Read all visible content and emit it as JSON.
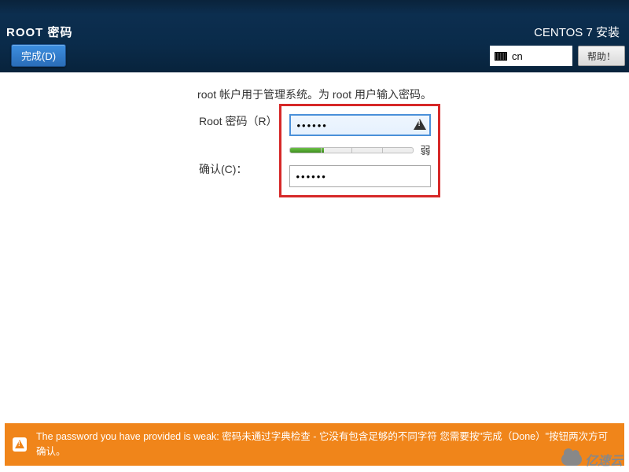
{
  "header": {
    "title": "ROOT 密码",
    "done_label": "完成(D)",
    "installer_name": "CENTOS 7 安装",
    "lang_code": "cn",
    "help_label": "帮助！"
  },
  "form": {
    "description": "root 帐户用于管理系统。为 root 用户输入密码。",
    "root_pw_label": "Root 密码（R）",
    "confirm_label": "确认(C)：",
    "root_pw_value": "••••••",
    "confirm_value": "••••••",
    "strength_text": "弱",
    "strength_fraction": 0.28
  },
  "warning": {
    "text": "The password you have provided is weak: 密码未通过字典检查 - 它没有包含足够的不同字符 您需要按\"完成（Done）\"按钮两次方可确认。"
  },
  "watermark": "亿速云"
}
